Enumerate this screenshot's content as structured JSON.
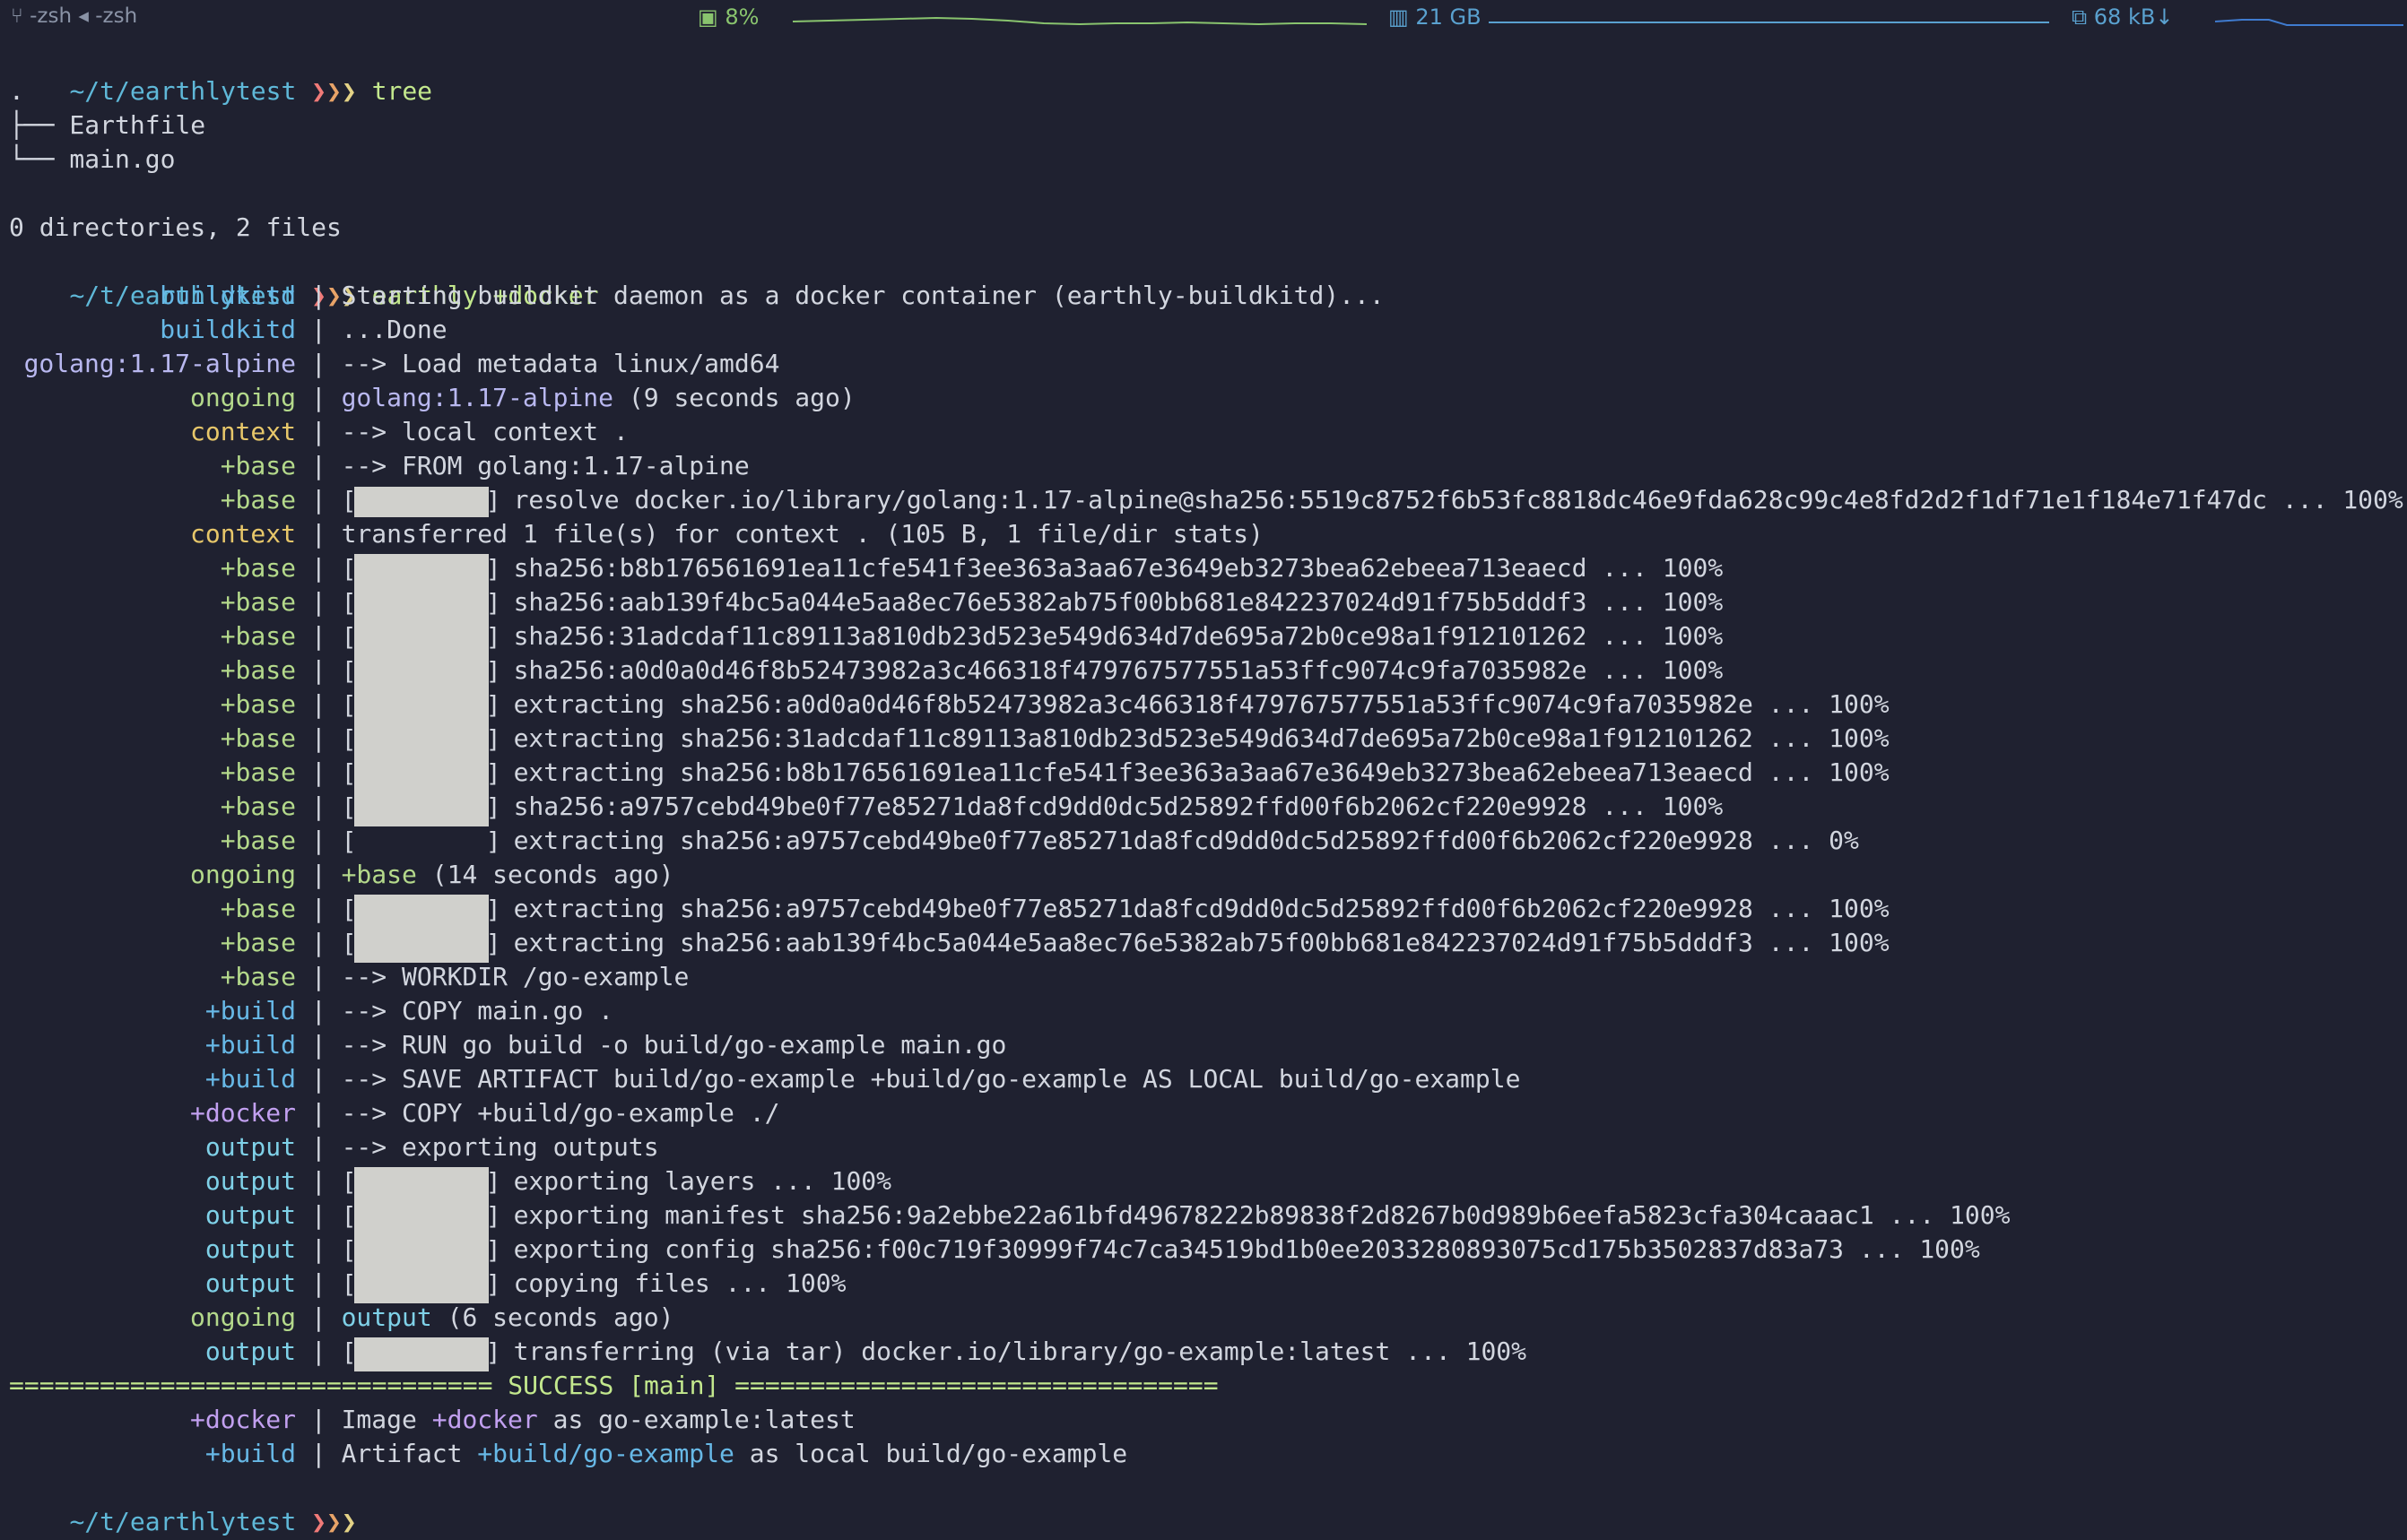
{
  "statusbar": {
    "tab_title": "-zsh ◂ -zsh",
    "cpu": "8%",
    "memory": "21 GB",
    "network": "68 kB↓",
    "colors": {
      "cpu": "#89c46e",
      "memory": "#5aa1cf",
      "network": "#5aa1cf"
    }
  },
  "prompt": {
    "path": "~/t/earthlytest",
    "arrows": [
      "❯",
      "❯",
      "❯"
    ]
  },
  "commands": {
    "tree": "tree",
    "earthly": "earthly +docker"
  },
  "tree_output": {
    "root": ".",
    "entries": [
      "├── Earthfile",
      "└── main.go"
    ],
    "summary": "0 directories, 2 files"
  },
  "log": [
    {
      "prefix": "buildkitd",
      "pc": "c-blue",
      "parts": [
        {
          "t": "Starting buildkit daemon as a docker container (earthly-buildkitd)..."
        }
      ]
    },
    {
      "prefix": "buildkitd",
      "pc": "c-blue",
      "parts": [
        {
          "t": "...Done"
        }
      ]
    },
    {
      "prefix": "golang:1.17-alpine",
      "pc": "c-lav",
      "parts": [
        {
          "t": "--> Load metadata linux/amd64"
        }
      ]
    },
    {
      "prefix": "ongoing",
      "pc": "c-green",
      "parts": [
        {
          "t": "golang:1.17-alpine",
          "c": "c-lav"
        },
        {
          "t": " (9 seconds ago)"
        }
      ]
    },
    {
      "prefix": "context",
      "pc": "c-yellow",
      "parts": [
        {
          "t": "--> local context ."
        }
      ]
    },
    {
      "prefix": "+base",
      "pc": "c-green",
      "parts": [
        {
          "t": "--> FROM golang:1.17-alpine"
        }
      ]
    },
    {
      "prefix": "+base",
      "pc": "c-green",
      "progress": 1.0,
      "thin": true,
      "parts": [
        {
          "t": "resolve docker.io/library/golang:1.17-alpine@sha256:5519c8752f6b53fc8818dc46e9fda628c99c4e8fd2d2f1df71e1f184e71f47dc ... 100%"
        }
      ]
    },
    {
      "prefix": "context",
      "pc": "c-yellow",
      "parts": [
        {
          "t": "transferred 1 file(s) for context . (105 B, 1 file/dir stats)"
        }
      ]
    },
    {
      "prefix": "+base",
      "pc": "c-green",
      "progress": 1.0,
      "parts": [
        {
          "t": "sha256:b8b176561691ea11cfe541f3ee363a3aa67e3649eb3273bea62ebeea713eaecd ... 100%"
        }
      ]
    },
    {
      "prefix": "+base",
      "pc": "c-green",
      "progress": 1.0,
      "parts": [
        {
          "t": "sha256:aab139f4bc5a044e5aa8ec76e5382ab75f00bb681e842237024d91f75b5dddf3 ... 100%"
        }
      ]
    },
    {
      "prefix": "+base",
      "pc": "c-green",
      "progress": 1.0,
      "parts": [
        {
          "t": "sha256:31adcdaf11c89113a810db23d523e549d634d7de695a72b0ce98a1f912101262 ... 100%"
        }
      ]
    },
    {
      "prefix": "+base",
      "pc": "c-green",
      "progress": 1.0,
      "parts": [
        {
          "t": "sha256:a0d0a0d46f8b52473982a3c466318f479767577551a53ffc9074c9fa7035982e ... 100%"
        }
      ]
    },
    {
      "prefix": "+base",
      "pc": "c-green",
      "progress": 1.0,
      "parts": [
        {
          "t": "extracting sha256:a0d0a0d46f8b52473982a3c466318f479767577551a53ffc9074c9fa7035982e ... 100%"
        }
      ]
    },
    {
      "prefix": "+base",
      "pc": "c-green",
      "progress": 1.0,
      "parts": [
        {
          "t": "extracting sha256:31adcdaf11c89113a810db23d523e549d634d7de695a72b0ce98a1f912101262 ... 100%"
        }
      ]
    },
    {
      "prefix": "+base",
      "pc": "c-green",
      "progress": 1.0,
      "parts": [
        {
          "t": "extracting sha256:b8b176561691ea11cfe541f3ee363a3aa67e3649eb3273bea62ebeea713eaecd ... 100%"
        }
      ]
    },
    {
      "prefix": "+base",
      "pc": "c-green",
      "progress": 1.0,
      "parts": [
        {
          "t": "sha256:a9757cebd49be0f77e85271da8fcd9dd0dc5d25892ffd00f6b2062cf220e9928 ... 100%"
        }
      ]
    },
    {
      "prefix": "+base",
      "pc": "c-green",
      "progress": 0.0,
      "parts": [
        {
          "t": "extracting sha256:a9757cebd49be0f77e85271da8fcd9dd0dc5d25892ffd00f6b2062cf220e9928 ... 0%"
        }
      ]
    },
    {
      "prefix": "ongoing",
      "pc": "c-green",
      "parts": [
        {
          "t": "+base",
          "c": "c-green"
        },
        {
          "t": " (14 seconds ago)"
        }
      ]
    },
    {
      "prefix": "+base",
      "pc": "c-green",
      "progress": 1.0,
      "parts": [
        {
          "t": "extracting sha256:a9757cebd49be0f77e85271da8fcd9dd0dc5d25892ffd00f6b2062cf220e9928 ... 100%"
        }
      ]
    },
    {
      "prefix": "+base",
      "pc": "c-green",
      "progress": 1.0,
      "parts": [
        {
          "t": "extracting sha256:aab139f4bc5a044e5aa8ec76e5382ab75f00bb681e842237024d91f75b5dddf3 ... 100%"
        }
      ]
    },
    {
      "prefix": "+base",
      "pc": "c-green",
      "parts": [
        {
          "t": "--> WORKDIR /go-example"
        }
      ]
    },
    {
      "prefix": "+build",
      "pc": "c-blue",
      "parts": [
        {
          "t": "--> COPY main.go ."
        }
      ]
    },
    {
      "prefix": "+build",
      "pc": "c-blue",
      "parts": [
        {
          "t": "--> RUN go build -o build/go-example main.go"
        }
      ]
    },
    {
      "prefix": "+build",
      "pc": "c-blue",
      "parts": [
        {
          "t": "--> SAVE ARTIFACT build/go-example +build/go-example AS LOCAL build/go-example"
        }
      ]
    },
    {
      "prefix": "+docker",
      "pc": "c-purple",
      "parts": [
        {
          "t": "--> COPY +build/go-example ./"
        }
      ]
    },
    {
      "prefix": "output",
      "pc": "c-cyan",
      "parts": [
        {
          "t": "--> exporting outputs"
        }
      ]
    },
    {
      "prefix": "output",
      "pc": "c-cyan",
      "progress": 1.0,
      "parts": [
        {
          "t": "exporting layers ... 100%"
        }
      ]
    },
    {
      "prefix": "output",
      "pc": "c-cyan",
      "progress": 1.0,
      "parts": [
        {
          "t": "exporting manifest sha256:9a2ebbe22a61bfd49678222b89838f2d8267b0d989b6eefa5823cfa304caaac1 ... 100%"
        }
      ]
    },
    {
      "prefix": "output",
      "pc": "c-cyan",
      "progress": 1.0,
      "parts": [
        {
          "t": "exporting config sha256:f00c719f30999f74c7ca34519bd1b0ee2033280893075cd175b3502837d83a73 ... 100%"
        }
      ]
    },
    {
      "prefix": "output",
      "pc": "c-cyan",
      "progress": 1.0,
      "parts": [
        {
          "t": "copying files ... 100%"
        }
      ]
    },
    {
      "prefix": "ongoing",
      "pc": "c-green",
      "parts": [
        {
          "t": "output",
          "c": "c-cyan"
        },
        {
          "t": " (6 seconds ago)"
        }
      ]
    },
    {
      "prefix": "output",
      "pc": "c-cyan",
      "progress": 1.0,
      "parts": [
        {
          "t": "transferring (via tar) docker.io/library/go-example:latest ... 100%"
        }
      ]
    }
  ],
  "success_banner": "================================ SUCCESS [main] ================================",
  "summary": [
    {
      "prefix": "+docker",
      "pc": "c-purple",
      "parts": [
        {
          "t": "Image "
        },
        {
          "t": "+docker",
          "c": "c-purple"
        },
        {
          "t": " as go-example:latest"
        }
      ]
    },
    {
      "prefix": "+build",
      "pc": "c-blue",
      "parts": [
        {
          "t": "Artifact "
        },
        {
          "t": "+build/go-example",
          "c": "c-blue"
        },
        {
          "t": " as local build/go-example"
        }
      ]
    }
  ]
}
